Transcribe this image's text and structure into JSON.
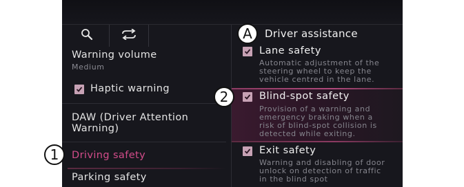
{
  "header": {
    "title": "Driver assistance"
  },
  "toolbar": {
    "search_icon": "search-icon",
    "sync_icon": "sync-arrows-icon"
  },
  "left_menu": {
    "warning_volume": {
      "label": "Warning volume",
      "value": "Medium"
    },
    "haptic_warning": {
      "label": "Haptic warning",
      "checked": true
    },
    "daw": {
      "line1": "DAW (Driver Attention",
      "line2": "Warning)"
    },
    "driving_safety": {
      "label": "Driving safety",
      "selected": true
    },
    "parking_safety": {
      "label": "Parking safety"
    }
  },
  "items": [
    {
      "title": "Lane safety",
      "checked": true,
      "desc": [
        "Automatic adjustment of the",
        "steering wheel to keep the",
        "vehicle centred in the lane."
      ]
    },
    {
      "title": "Blind-spot safety",
      "checked": true,
      "highlighted": true,
      "desc": [
        "Provision of a warning and",
        "emergency braking when a",
        "risk of blind-spot collision is",
        "detected while exiting."
      ]
    },
    {
      "title": "Exit safety",
      "checked": true,
      "desc": [
        "Warning and disabling of door",
        "unlock on detection of traffic",
        "in the blind spot"
      ]
    }
  ],
  "callouts": {
    "a": "A",
    "one": "1",
    "two": "2"
  },
  "colors": {
    "accent": "#d34c8a",
    "checkbox": "#c7a2b5",
    "background": "#17171d"
  }
}
